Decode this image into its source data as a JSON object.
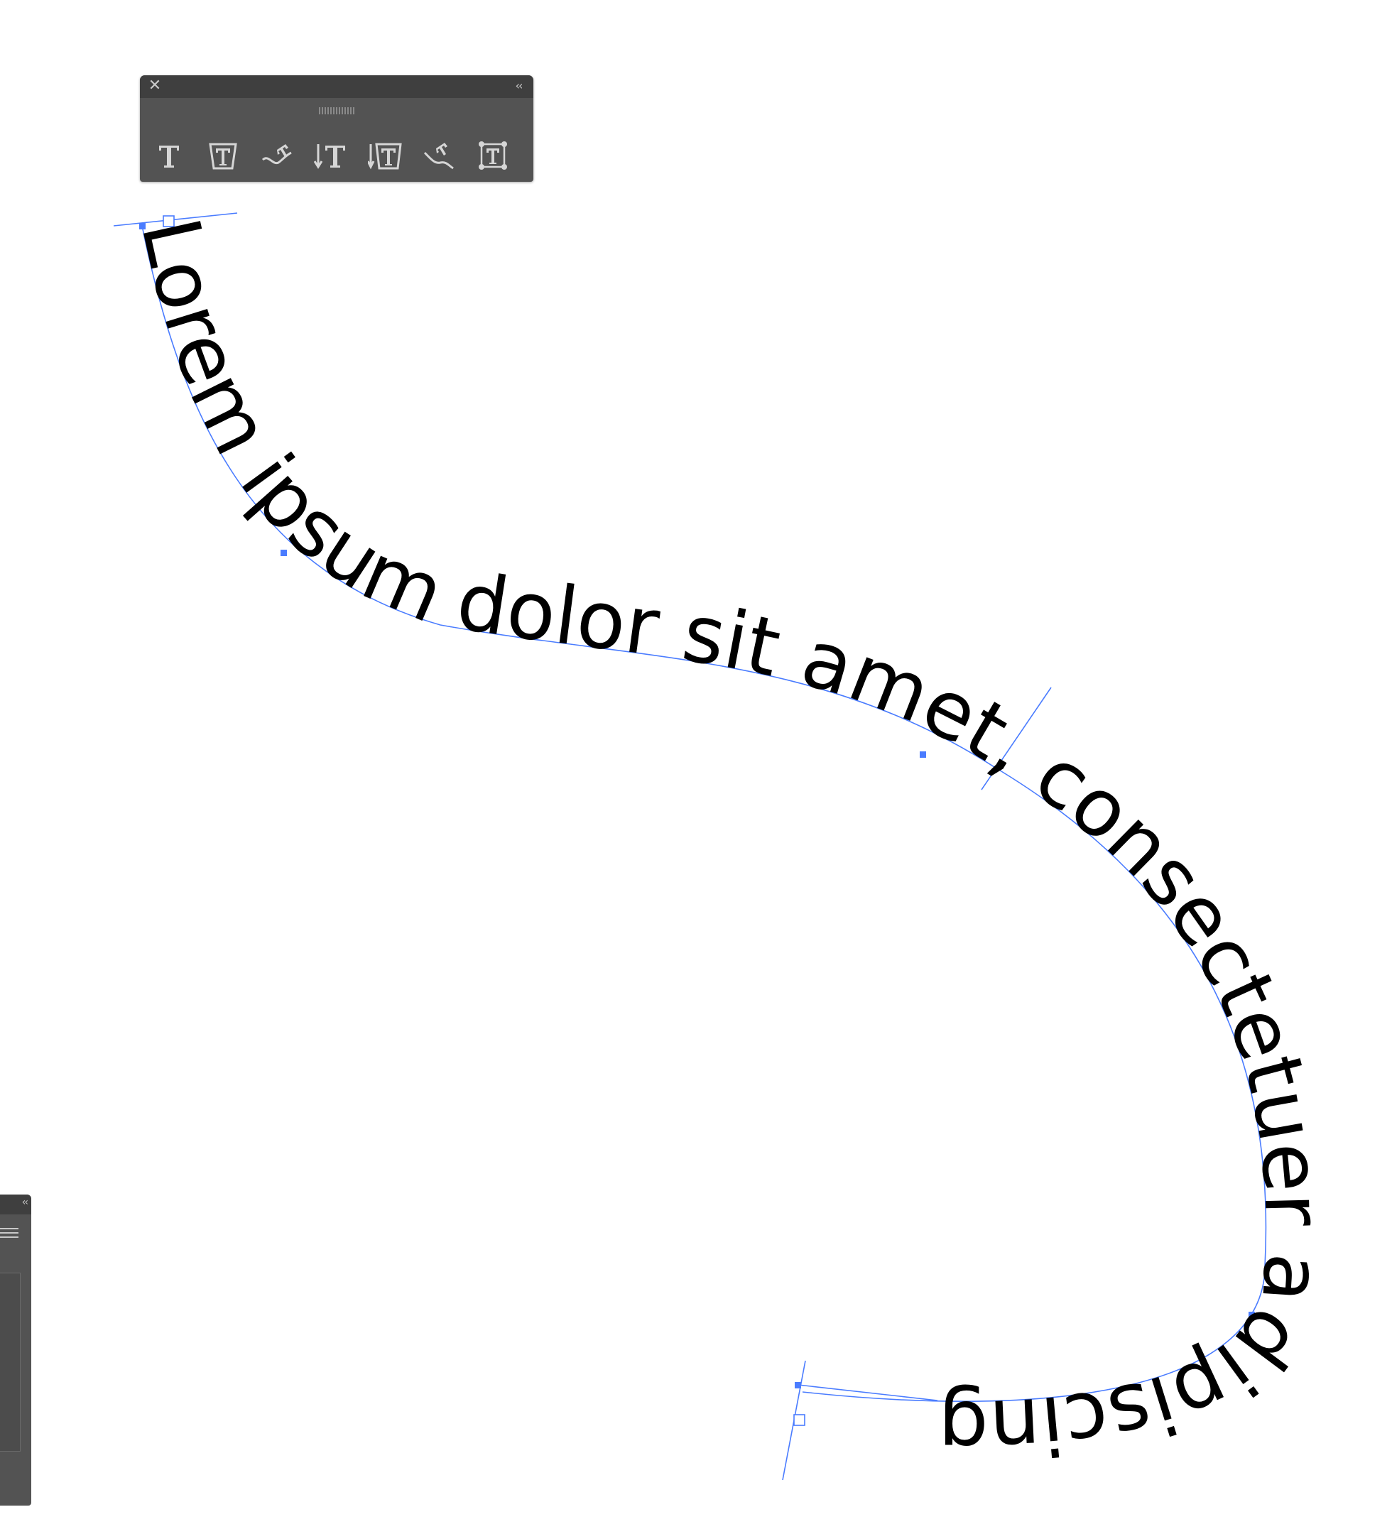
{
  "type_panel": {
    "close_icon": "close-icon",
    "collapse_icon": "collapse-double-chevron-icon",
    "tools": [
      {
        "name": "type-tool",
        "icon": "type-icon"
      },
      {
        "name": "area-type-tool",
        "icon": "area-type-icon"
      },
      {
        "name": "type-on-path-tool",
        "icon": "type-on-path-icon"
      },
      {
        "name": "vertical-type-tool",
        "icon": "vertical-type-icon"
      },
      {
        "name": "vertical-area-type-tool",
        "icon": "vertical-area-type-icon"
      },
      {
        "name": "vertical-type-on-path-tool",
        "icon": "vertical-type-on-path-icon"
      },
      {
        "name": "touch-type-tool",
        "icon": "touch-type-icon"
      }
    ]
  },
  "canvas": {
    "path_text": "Lorem ipsum dolor sit amet, consectetuer adipiscing",
    "selection_color": "#4a7cff"
  },
  "dock_panel": {
    "collapse_icon": "collapse-double-chevron-icon",
    "menu_icon": "panel-menu-icon"
  }
}
